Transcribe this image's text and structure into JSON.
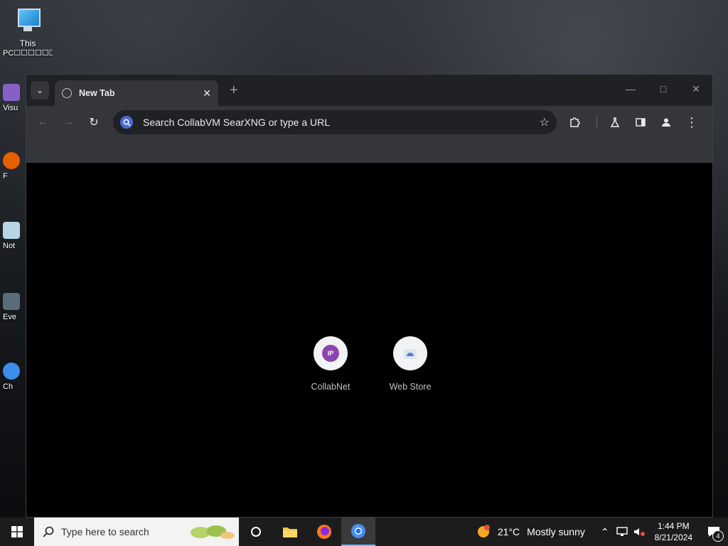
{
  "desktop": {
    "icons": [
      {
        "label_line1": "This",
        "label_line2": "PC☐☐☐☐☐☐☐☐☐☐..."
      }
    ],
    "side_stubs": [
      "Visu",
      "F",
      "Not",
      "Eve",
      "Ch"
    ]
  },
  "browser": {
    "tab": {
      "title": "New Tab"
    },
    "omnibox": {
      "placeholder": "Search CollabVM SearXNG or type a URL"
    },
    "shortcuts": [
      {
        "label": "CollabNet",
        "badge": "IP"
      },
      {
        "label": "Web Store"
      }
    ]
  },
  "taskbar": {
    "search_placeholder": "Type here to search",
    "weather": {
      "temp": "21°C",
      "desc": "Mostly sunny"
    },
    "clock": {
      "time": "1:44 PM",
      "date": "8/21/2024"
    },
    "notifications_count": "4"
  },
  "colors": {
    "accent": "#8e44ad",
    "taskbar_active": "#7ab7ff",
    "omnibox_g": "#4c6bd8"
  }
}
